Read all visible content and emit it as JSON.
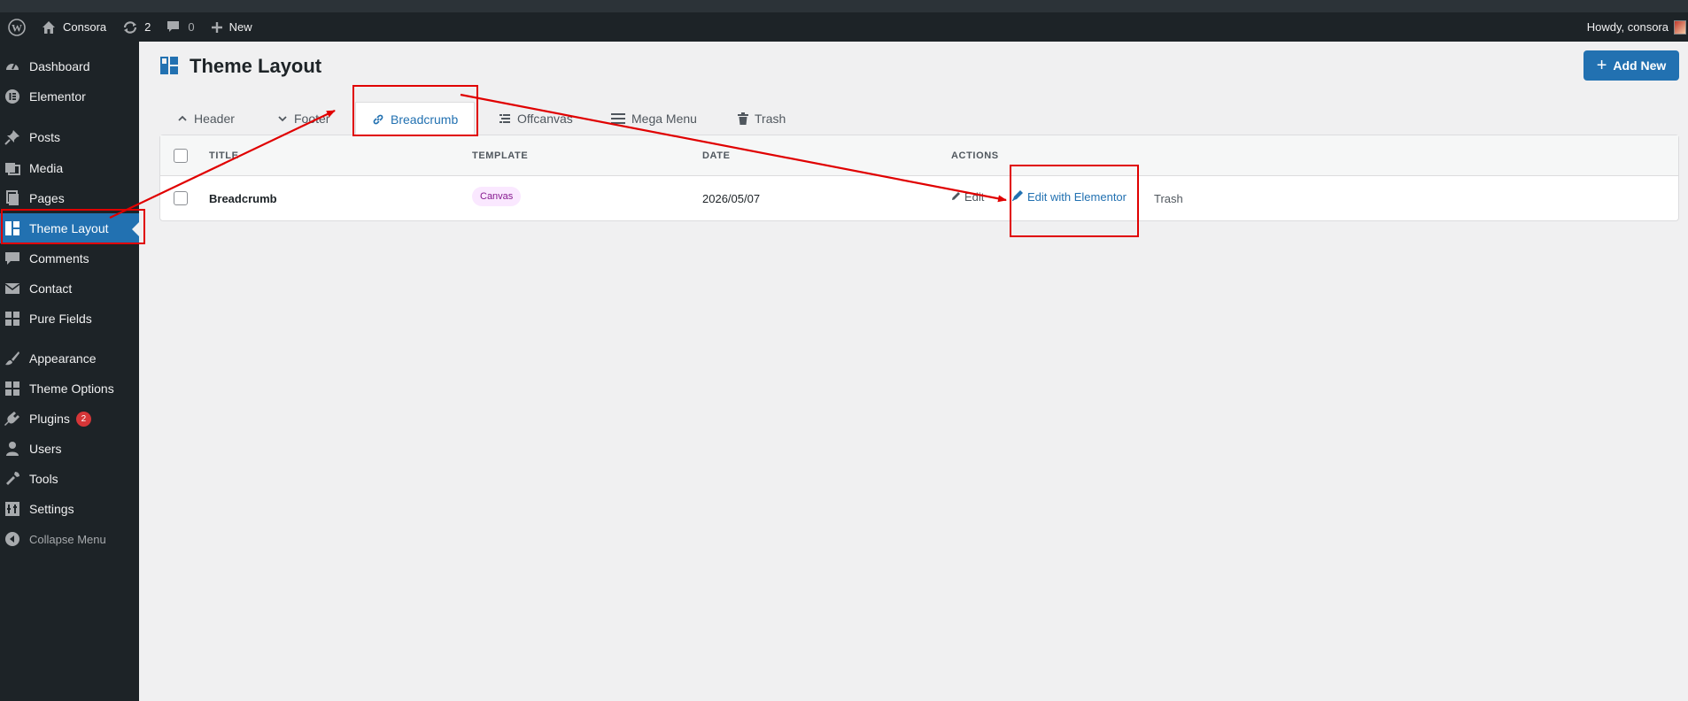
{
  "adminbar": {
    "site_name": "Consora",
    "updates_count": "2",
    "comments_count": "0",
    "new_label": "New",
    "howdy": "Howdy, consora"
  },
  "sidebar": {
    "items": [
      {
        "label": "Dashboard",
        "icon": "gauge-icon"
      },
      {
        "label": "Elementor",
        "icon": "elementor-icon"
      },
      {
        "label": "Posts",
        "icon": "pin-icon"
      },
      {
        "label": "Media",
        "icon": "media-icon"
      },
      {
        "label": "Pages",
        "icon": "pages-icon"
      },
      {
        "label": "Theme Layout",
        "icon": "layout-icon",
        "current": true
      },
      {
        "label": "Comments",
        "icon": "comment-icon"
      },
      {
        "label": "Contact",
        "icon": "mail-icon"
      },
      {
        "label": "Pure Fields",
        "icon": "grid-icon"
      },
      {
        "label": "Appearance",
        "icon": "brush-icon"
      },
      {
        "label": "Theme Options",
        "icon": "grid-icon"
      },
      {
        "label": "Plugins",
        "icon": "plug-icon",
        "badge": "2"
      },
      {
        "label": "Users",
        "icon": "user-icon"
      },
      {
        "label": "Tools",
        "icon": "wrench-icon"
      },
      {
        "label": "Settings",
        "icon": "settings-icon"
      }
    ],
    "collapse_label": "Collapse Menu"
  },
  "page": {
    "title": "Theme Layout",
    "add_new_label": "Add New"
  },
  "tabs": [
    {
      "label": "Header",
      "icon": "chevron-up-icon"
    },
    {
      "label": "Footer",
      "icon": "chevron-down-icon"
    },
    {
      "label": "Breadcrumb",
      "icon": "link-icon",
      "active": true
    },
    {
      "label": "Offcanvas",
      "icon": "offcanvas-icon"
    },
    {
      "label": "Mega Menu",
      "icon": "menu-icon"
    },
    {
      "label": "Trash",
      "icon": "trash-icon"
    }
  ],
  "table": {
    "columns": [
      "TITLE",
      "TEMPLATE",
      "DATE",
      "ACTIONS"
    ],
    "rows": [
      {
        "title": "Breadcrumb",
        "template": "Canvas",
        "date": "2026/05/07",
        "actions": {
          "edit": "Edit",
          "edit_elementor": "Edit with Elementor",
          "trash": "Trash"
        }
      }
    ]
  },
  "colors": {
    "accent": "#2271b1",
    "adminbar_bg": "#1d2327",
    "annotation": "#e00000",
    "pill_bg": "#fae8ff",
    "pill_text": "#86198f"
  }
}
